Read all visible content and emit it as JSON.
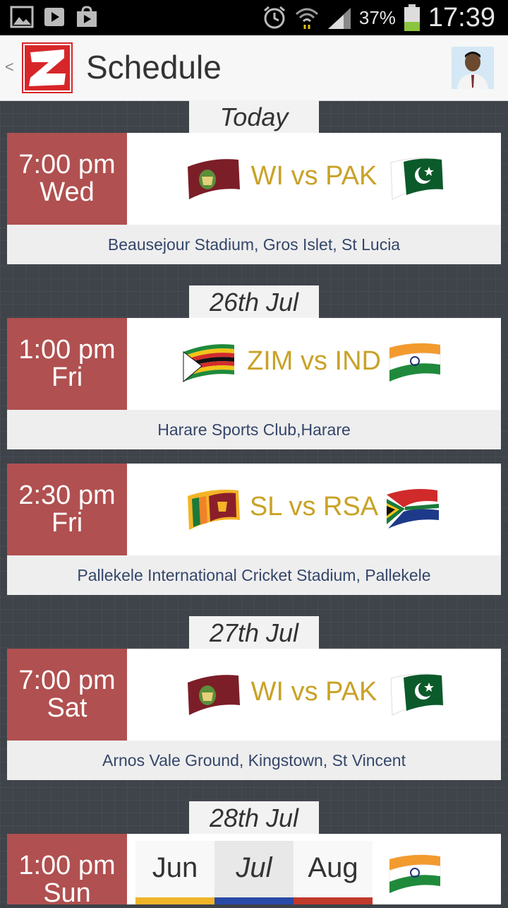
{
  "status_bar": {
    "battery": "37%",
    "time": "17:39",
    "icons": [
      "gallery-icon",
      "play-store-icon",
      "shop-icon",
      "alarm-icon",
      "wifi-icon",
      "signal-icon",
      "battery-icon"
    ]
  },
  "header": {
    "back": "<",
    "title": "Schedule"
  },
  "colors": {
    "time_box": "#b05050",
    "match_title": "#c9a227",
    "venue_text": "#34466a",
    "month_bars": [
      "#f0b429",
      "#2a4aa8",
      "#c0392b"
    ]
  },
  "dates": [
    "Today",
    "26th Jul",
    "27th Jul",
    "28th Jul"
  ],
  "matches": [
    {
      "time": "7:00 pm",
      "day": "Wed",
      "title": "WI vs PAK",
      "home_flag": "west-indies-flag-icon",
      "away_flag": "pakistan-flag-icon",
      "venue": "Beausejour Stadium, Gros Islet, St Lucia"
    },
    {
      "time": "1:00 pm",
      "day": "Fri",
      "title": "ZIM vs IND",
      "home_flag": "zimbabwe-flag-icon",
      "away_flag": "india-flag-icon",
      "venue": "Harare Sports Club,Harare"
    },
    {
      "time": "2:30 pm",
      "day": "Fri",
      "title": "SL vs RSA",
      "home_flag": "sri-lanka-flag-icon",
      "away_flag": "south-africa-flag-icon",
      "venue": "Pallekele International Cricket Stadium, Pallekele"
    },
    {
      "time": "7:00 pm",
      "day": "Sat",
      "title": "WI vs PAK",
      "home_flag": "west-indies-flag-icon",
      "away_flag": "pakistan-flag-icon",
      "venue": "Arnos Vale Ground, Kingstown, St Vincent"
    },
    {
      "time": "1:00 pm",
      "day": "Sun",
      "title": "",
      "home_flag": "",
      "away_flag": "india-flag-icon",
      "venue": ""
    }
  ],
  "month_picker": {
    "months": [
      "Jun",
      "Jul",
      "Aug"
    ],
    "selected": "Jul"
  }
}
